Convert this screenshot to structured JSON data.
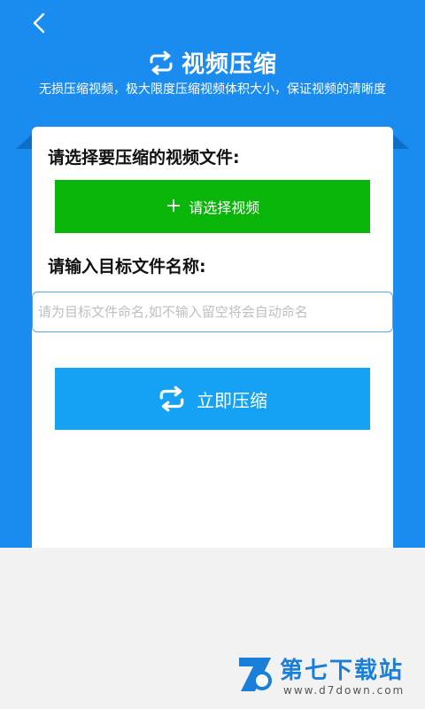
{
  "header": {
    "back_icon": "chevron-left-icon",
    "title_icon": "repeat-arrows-icon",
    "title": "视频压缩",
    "subtitle": "无损压缩视频，极大限度压缩视频体积大小，保证视频的清晰度"
  },
  "form": {
    "select_label": "请选择要压缩的视频文件:",
    "select_button": "请选择视频",
    "select_button_icon": "plus-icon",
    "name_label": "请输入目标文件名称:",
    "name_input_value": "",
    "name_input_placeholder": "请为目标文件命名,如不输入留空将会自动命名",
    "compress_button": "立即压缩",
    "compress_button_icon": "repeat-arrows-icon"
  },
  "watermark": {
    "text": "第七下载站",
    "url": "www.d7down.com"
  },
  "colors": {
    "primary": "#1a8cf0",
    "select_button": "#0bb60b",
    "compress_button": "#15a2f5",
    "input_border": "#5aa5e8"
  }
}
